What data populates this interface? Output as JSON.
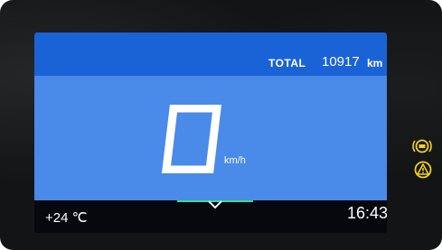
{
  "odometer": {
    "label": "TOTAL",
    "value": "10917",
    "unit": "km"
  },
  "speed": {
    "value": "0",
    "unit": "km/h"
  },
  "status_bar": {
    "temperature": "+24 ℃",
    "time": "16:43"
  },
  "indicators": [
    {
      "name": "abs-warning-icon",
      "color": "#f2d21b",
      "active": true
    },
    {
      "name": "general-warning-icon",
      "color": "#f2d21b",
      "active": true
    }
  ],
  "colors": {
    "top_band": "#1a63d6",
    "main_panel": "#4a8ae8",
    "accent_green": "#3ddc84",
    "warning_yellow": "#f2d21b"
  }
}
